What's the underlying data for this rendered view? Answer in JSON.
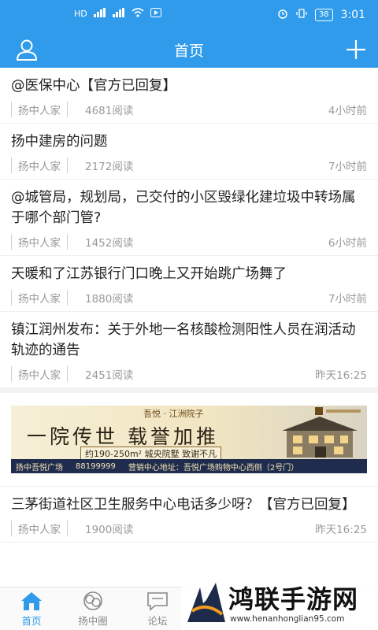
{
  "status_bar": {
    "sim1": "HD",
    "sim2": "HD",
    "network": "4G",
    "network2": "4G",
    "battery": "38",
    "time": "3:01"
  },
  "header": {
    "title": "首页",
    "user_icon": "user-icon",
    "add_icon": "plus-icon",
    "color": "#2f9bea"
  },
  "posts": [
    {
      "title": "@医保中心【官方已回复】",
      "source": "扬中人家",
      "reads": "4681阅读",
      "time": "4小时前"
    },
    {
      "title": "扬中建房的问题",
      "source": "扬中人家",
      "reads": "2172阅读",
      "time": "7小时前"
    },
    {
      "title": "@城管局，规划局，己交付的小区毁绿化建垃圾中转场属于哪个部门管?",
      "source": "扬中人家",
      "reads": "1452阅读",
      "time": "6小时前"
    },
    {
      "title": "天暖和了江苏银行门口晚上又开始跳广场舞了",
      "source": "扬中人家",
      "reads": "1880阅读",
      "time": "7小时前"
    },
    {
      "title": "镇江润州发布：关于外地一名核酸检测阳性人员在润活动轨迹的通告",
      "source": "扬中人家",
      "reads": "2451阅读",
      "time": "昨天16:25"
    }
  ],
  "ad": {
    "top_line": "吾悦 · 江洲院子",
    "slogan": "一院传世 载誉加推",
    "area": "约190-250m² 城央院墅 致谢不凡",
    "bottom_name": "扬中吾悦广场",
    "bottom_phone": "88199999",
    "bottom_addr": "营销中心地址：吾悦广场购物中心西侧（2号门）"
  },
  "posts_after_ad": [
    {
      "title": "三茅街道社区卫生服务中心电话多少呀？【官方已回复】",
      "source": "扬中人家",
      "reads": "1900阅读",
      "time": "昨天16:25"
    }
  ],
  "tabbar": {
    "tabs": [
      {
        "label": "首页",
        "icon": "home-icon"
      },
      {
        "label": "扬中圈",
        "icon": "circle-icon"
      },
      {
        "label": "论坛",
        "icon": "forum-icon"
      }
    ],
    "active_color": "#2f9bea"
  },
  "watermark": {
    "text": "鸿联手游网",
    "url": "www.henanhonglian95.com"
  }
}
